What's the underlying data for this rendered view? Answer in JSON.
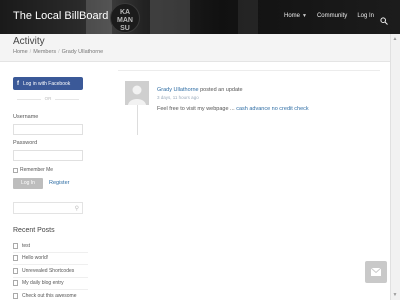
{
  "site": {
    "title": "The Local BillBoard"
  },
  "header_badge": {
    "lines": [
      "KA",
      "MAN",
      "SU"
    ]
  },
  "nav": {
    "items": [
      {
        "label": "Home",
        "has_caret": true
      },
      {
        "label": "Community",
        "has_caret": false
      },
      {
        "label": "Log In",
        "has_caret": false
      }
    ],
    "search_icon": "search-icon"
  },
  "page": {
    "title": "Activity",
    "breadcrumb": [
      "Home",
      "Members",
      "Grady Ullathorne"
    ]
  },
  "sidebar": {
    "facebook_button": "Log in with Facebook",
    "or_text": "OR",
    "username_label": "Username",
    "password_label": "Password",
    "remember_label": "Remember Me",
    "login_button": "Log In",
    "register_link": "Register",
    "recent_posts_title": "Recent Posts",
    "recent_posts": [
      "test",
      "Hello world!",
      "Unrevealed Shortcodes",
      "My daily blog entry",
      "Check out this awesome"
    ]
  },
  "activity": {
    "user": "Grady Ullathorne",
    "action": "posted an update",
    "time": "3 days, 11 hours ago",
    "content_prefix": "Feel free to visit my webpage ...",
    "content_link": "cash advance no credit check"
  },
  "colors": {
    "link": "#2e6da4",
    "facebook": "#3b5998",
    "header": "#1c1c1c"
  }
}
